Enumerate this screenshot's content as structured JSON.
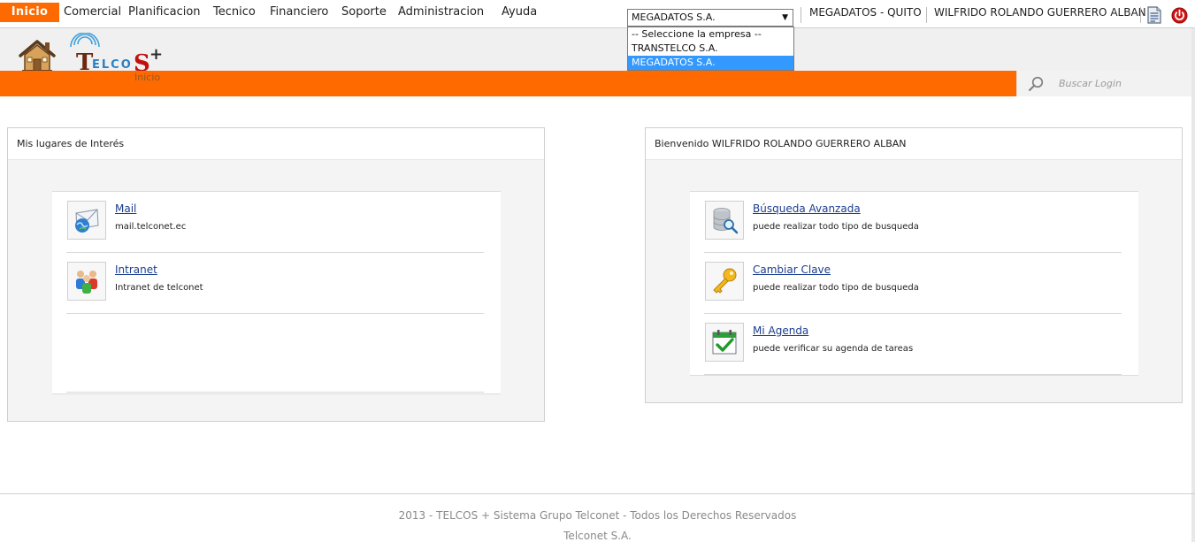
{
  "menu": {
    "home": "Inicio",
    "items": [
      "Comercial",
      "Planificacion",
      "Tecnico",
      "Financiero",
      "Soporte",
      "Administracion",
      "Ayuda"
    ]
  },
  "company_select": {
    "value": "MEGADATOS S.A.",
    "options": [
      "-- Seleccione la empresa --",
      "TRANSTELCO S.A.",
      "MEGADATOS S.A."
    ],
    "selected_index": 2
  },
  "session": {
    "office": "MEGADATOS - QUITO",
    "user": "WILFRIDO ROLANDO GUERRERO ALBAN"
  },
  "logo": {
    "brand": "TELCOS",
    "plus": "+",
    "subtitle": "Inicio"
  },
  "search": {
    "placeholder": "Buscar Login"
  },
  "left_panel": {
    "title": "Mis lugares de Interés",
    "entries": [
      {
        "label": "Mail",
        "description": "mail.telconet.ec",
        "icon": "mail-icon"
      },
      {
        "label": "Intranet",
        "description": "Intranet de telconet",
        "icon": "people-icon"
      }
    ]
  },
  "right_panel": {
    "title": "Bienvenido WILFRIDO ROLANDO GUERRERO ALBAN",
    "entries": [
      {
        "label": "Búsqueda Avanzada",
        "description": "puede realizar todo tipo de busqueda",
        "icon": "database-search-icon"
      },
      {
        "label": "Cambiar Clave",
        "description": "puede realizar todo tipo de busqueda",
        "icon": "key-icon"
      },
      {
        "label": "Mi Agenda",
        "description": "puede verificar su agenda de tareas",
        "icon": "calendar-check-icon"
      }
    ]
  },
  "footer": {
    "line1": "2013 - TELCOS + Sistema Grupo Telconet - Todos los Derechos Reservados",
    "line2": "Telconet S.A."
  },
  "colors": {
    "accent": "#ff6a00",
    "link": "#1a3d8f",
    "selection": "#3399ff"
  }
}
